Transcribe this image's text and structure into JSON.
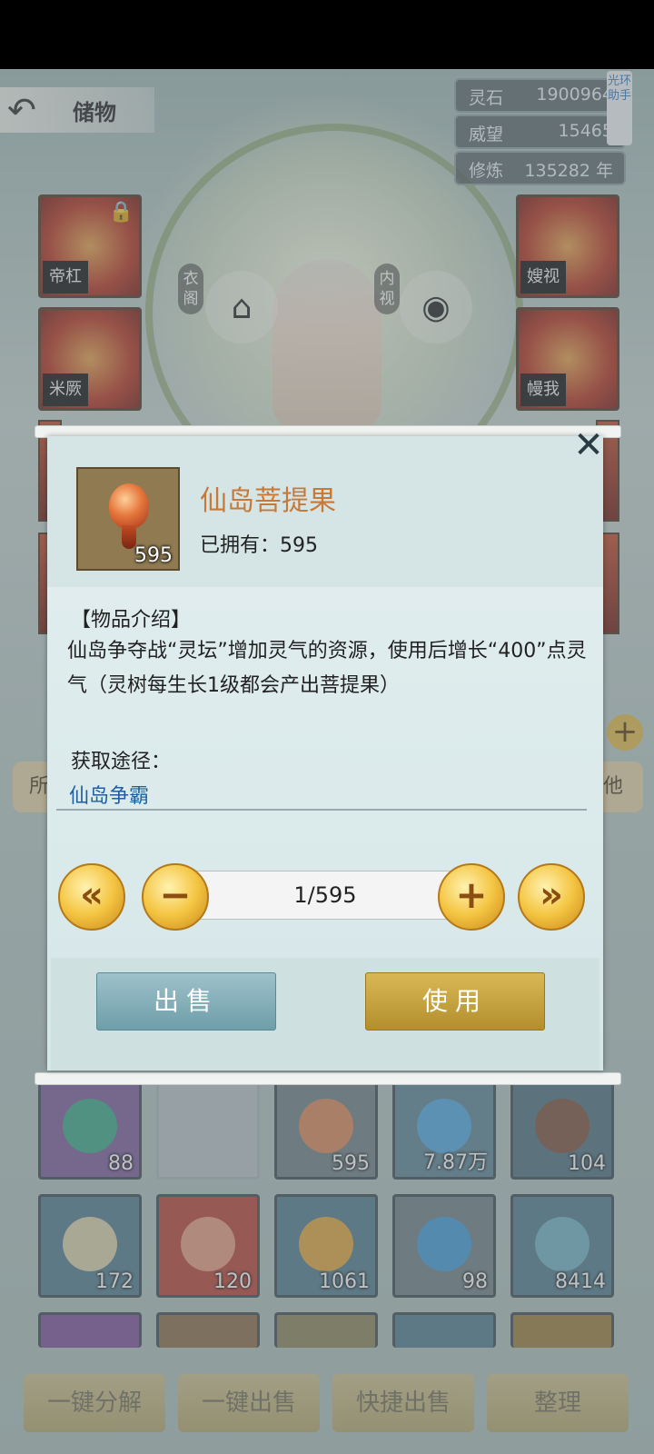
{
  "header": {
    "back_label": "储物"
  },
  "resources": [
    {
      "key": "灵石",
      "value": "1900964"
    },
    {
      "key": "威望",
      "value": "15465"
    },
    {
      "key": "修炼",
      "value": "135282 年"
    }
  ],
  "helper_badge": "光环助手",
  "equipment_left": [
    {
      "label": "帝杠"
    },
    {
      "label": "米厥"
    }
  ],
  "equipment_right": [
    {
      "label": "嫂视"
    },
    {
      "label": "幔我"
    }
  ],
  "character_buttons": {
    "left_label": "衣阁",
    "right_label": "内视"
  },
  "side_tabs": {
    "left": "所",
    "right": "他"
  },
  "modal": {
    "item_name": "仙岛菩提果",
    "icon_count": "595",
    "owned_text": "已拥有：595",
    "desc_heading": "【物品介绍】",
    "desc_body": "仙岛争夺战“灵坛”增加灵气的资源，使用后增长“400”点灵气（灵树每生长1级都会产出菩提果）",
    "source_label": "获取途径：",
    "source_link": "仙岛争霸",
    "quantity": "1/595",
    "sell_label": "出售",
    "use_label": "使用"
  },
  "inventory_rows": [
    [
      "88",
      "",
      "595",
      "7.87万",
      "104"
    ],
    [
      "172",
      "120",
      "1061",
      "98",
      "8414"
    ]
  ],
  "bottom_buttons": [
    "一键分解",
    "一键出售",
    "快捷出售",
    "整理"
  ]
}
